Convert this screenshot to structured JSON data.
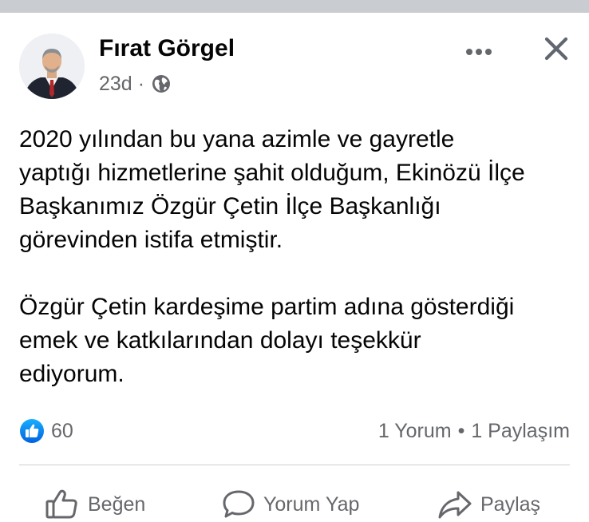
{
  "post": {
    "author_name": "Fırat Görgel",
    "time_ago": "23d",
    "separator": "·",
    "privacy_icon": "globe-icon",
    "menu_icon": "more-horizontal-icon",
    "close_icon": "close-icon",
    "paragraphs": [
      [
        "2020 yılından bu yana azimle ve gayretle",
        "yaptığı hizmetlerine şahit olduğum, Ekinözü İlçe",
        "Başkanımız Özgür Çetin İlçe Başkanlığı",
        "görevinden istifa etmiştir."
      ],
      [
        "Özgür Çetin kardeşime partim adına gösterdiği",
        "emek ve katkılarından dolayı teşekkür",
        "ediyorum."
      ]
    ]
  },
  "stats": {
    "reaction_icon": "like-reaction-icon",
    "reaction_count": "60",
    "comments": "1 Yorum",
    "dot": "•",
    "shares": "1 Paylaşım"
  },
  "actions": {
    "like": {
      "label": "Beğen",
      "icon": "thumbs-up-icon"
    },
    "comment": {
      "label": "Yorum Yap",
      "icon": "comment-icon"
    },
    "share": {
      "label": "Paylaş",
      "icon": "share-icon"
    }
  },
  "colors": {
    "primary_text": "#050505",
    "secondary_text": "#65676b",
    "like_blue": "#1877f2",
    "divider": "#ced0d4",
    "top_strip": "#c9ccd1"
  }
}
